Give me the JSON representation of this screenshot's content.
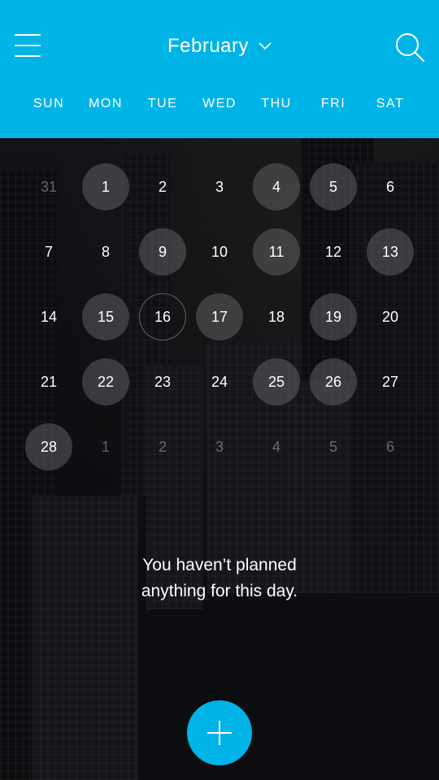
{
  "header": {
    "month": "February",
    "weekdays": [
      "SUN",
      "MON",
      "TUE",
      "WED",
      "THU",
      "FRI",
      "SAT"
    ],
    "icons": {
      "menu": "hamburger-menu-icon",
      "dropdown": "chevron-down-icon",
      "search": "search-icon",
      "add": "plus-icon"
    }
  },
  "calendar": {
    "days": [
      {
        "label": "31",
        "muted": true,
        "has_event": false
      },
      {
        "label": "1",
        "muted": false,
        "has_event": true
      },
      {
        "label": "2",
        "muted": false,
        "has_event": false
      },
      {
        "label": "3",
        "muted": false,
        "has_event": false
      },
      {
        "label": "4",
        "muted": false,
        "has_event": true
      },
      {
        "label": "5",
        "muted": false,
        "has_event": true
      },
      {
        "label": "6",
        "muted": false,
        "has_event": false
      },
      {
        "label": "7",
        "muted": false,
        "has_event": false
      },
      {
        "label": "8",
        "muted": false,
        "has_event": false
      },
      {
        "label": "9",
        "muted": false,
        "has_event": true
      },
      {
        "label": "10",
        "muted": false,
        "has_event": false
      },
      {
        "label": "11",
        "muted": false,
        "has_event": true
      },
      {
        "label": "12",
        "muted": false,
        "has_event": false
      },
      {
        "label": "13",
        "muted": false,
        "has_event": true
      },
      {
        "label": "14",
        "muted": false,
        "has_event": false
      },
      {
        "label": "15",
        "muted": false,
        "has_event": true
      },
      {
        "label": "16",
        "muted": false,
        "has_event": false,
        "selected": true
      },
      {
        "label": "17",
        "muted": false,
        "has_event": true
      },
      {
        "label": "18",
        "muted": false,
        "has_event": false
      },
      {
        "label": "19",
        "muted": false,
        "has_event": true
      },
      {
        "label": "20",
        "muted": false,
        "has_event": false
      },
      {
        "label": "21",
        "muted": false,
        "has_event": false
      },
      {
        "label": "22",
        "muted": false,
        "has_event": true
      },
      {
        "label": "23",
        "muted": false,
        "has_event": false
      },
      {
        "label": "24",
        "muted": false,
        "has_event": false
      },
      {
        "label": "25",
        "muted": false,
        "has_event": true
      },
      {
        "label": "26",
        "muted": false,
        "has_event": true
      },
      {
        "label": "27",
        "muted": false,
        "has_event": false
      },
      {
        "label": "28",
        "muted": false,
        "has_event": true
      },
      {
        "label": "1",
        "muted": true,
        "has_event": false
      },
      {
        "label": "2",
        "muted": true,
        "has_event": false
      },
      {
        "label": "3",
        "muted": true,
        "has_event": false
      },
      {
        "label": "4",
        "muted": true,
        "has_event": false
      },
      {
        "label": "5",
        "muted": true,
        "has_event": false
      },
      {
        "label": "6",
        "muted": true,
        "has_event": false
      }
    ]
  },
  "empty_state": {
    "line1": "You haven’t planned",
    "line2": "anything for this day."
  },
  "colors": {
    "accent": "#00b4e8",
    "text": "#ffffff"
  }
}
